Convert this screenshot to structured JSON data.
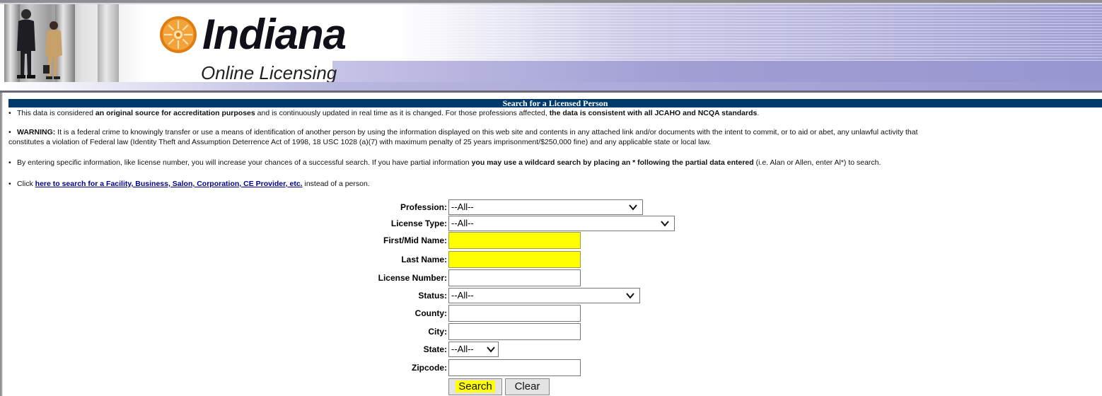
{
  "header": {
    "brand": "Indiana",
    "subtitle": "Online Licensing"
  },
  "page": {
    "title": "Search for a Licensed Person",
    "notices": {
      "source_pre": "This data is considered ",
      "source_bold": "an original source for accreditation purposes",
      "source_mid": " and is continuously updated in real time as it is changed. For those professions affected, ",
      "source_bold2": "the data is consistent with all JCAHO and NCQA standards",
      "source_end": ".",
      "warning_label": "WARNING:",
      "warning_text_line1": " It is a federal crime to knowingly transfer or use a means of identification of another person by using the information displayed on this web site and contents in any attached link and/or documents with the intent to commit, or to aid or abet, any unlawful activity that",
      "warning_text_line2": "constitutes a violation of Federal law (Identity Theft and Assumption Deterrence Act of 1998, 18 USC 1028 (a)(7) with maximum penalty of 25 years imprisonment/$250,000 fine) and any applicable state or local law.",
      "tips_pre": "By entering specific information, like license number, you will increase your chances of a successful search. If you have partial information ",
      "tips_bold": "you may use a wildcard search by placing an * following the partial data entered",
      "tips_end": " (i.e. Alan or Allen, enter Al*) to search.",
      "click_pre": "Click ",
      "click_link": "here to search for a Facility, Business, Salon, Corporation, CE Provider, etc.",
      "click_end": " instead of a person."
    }
  },
  "form": {
    "profession_label": "Profession:",
    "profession_value": "--All--",
    "license_type_label": "License Type:",
    "license_type_value": "--All--",
    "first_name_label": "First/Mid Name:",
    "first_name_value": "",
    "last_name_label": "Last Name:",
    "last_name_value": "",
    "license_number_label": "License Number:",
    "license_number_value": "",
    "status_label": "Status:",
    "status_value": "--All--",
    "county_label": "County:",
    "county_value": "",
    "city_label": "City:",
    "city_value": "",
    "state_label": "State:",
    "state_value": "--All--",
    "zipcode_label": "Zipcode:",
    "zipcode_value": "",
    "search_label": "Search",
    "clear_label": "Clear"
  },
  "colors": {
    "title_bar": "#003a6b",
    "highlight": "#ffff00",
    "link": "#00008b"
  },
  "icons": {
    "seal": "indiana-seal-icon",
    "dropdown": "chevron-down-icon"
  }
}
